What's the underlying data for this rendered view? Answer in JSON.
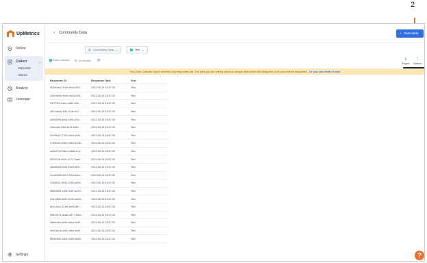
{
  "annotation": {
    "step_number": "2"
  },
  "brand": {
    "name": "UpMetrics",
    "accent": "#e8722c",
    "primary": "#2f6fde"
  },
  "sidebar": {
    "define": "Define",
    "collect": "Collect",
    "collect_sub": [
      "Data sets",
      "Stories"
    ],
    "analyze": "Analyze",
    "leverage": "Leverage",
    "settings": "Settings"
  },
  "header": {
    "title": "Community Data",
    "data_table_button": "Data table"
  },
  "tabs": [
    {
      "label": "Community Data",
      "active": false
    },
    {
      "label": "Test",
      "active": true
    }
  ],
  "toolbar": {
    "data_collector": "Data Collector",
    "records": "18 records",
    "export_label": "Export",
    "options_label": "Options",
    "options_tooltip": "Data Collector Options"
  },
  "banner": {
    "text": "This Data Collector hasn't received any responses yet. The data you are seeing below is sample data which will disappear once you receive responses.",
    "link": "Or you can delete it now."
  },
  "table": {
    "headers": [
      "Response ID",
      "Response Date",
      "Test"
    ],
    "rows": [
      [
        "003d0da2-3c8d-4b4a-8b3…",
        "2024-08-15 18:57:30",
        "Test"
      ],
      [
        "2a9ed4ee-0beb-4b45-808…",
        "2024-08-15 18:57:30",
        "Test"
      ],
      [
        "33f77f42-3a2a-4583-8d9…",
        "2024-08-15 18:57:30",
        "Test"
      ],
      [
        "3801a6c6-3f3e-414e-9e7…",
        "2024-08-15 18:57:30",
        "Test"
      ],
      [
        "a69d09f8-aec8-4e91-b6d…",
        "2024-08-15 18:57:30",
        "Test"
      ],
      [
        "226ecffa-24f4-4e21-b0f9-…",
        "2024-08-15 18:57:30",
        "Test"
      ],
      [
        "2e29f916-7763-49e3-82fe…",
        "2024-08-15 18:57:30",
        "Test"
      ],
      [
        "c755f162-93b4-49e2-b108…",
        "2024-08-15 18:57:30",
        "Test"
      ],
      [
        "ad9b9733-28ed-4368-a7d…",
        "2024-08-15 18:57:30",
        "Test"
      ],
      [
        "6f2097df-a92e-4171-9aa9…",
        "2024-08-15 18:57:30",
        "Test"
      ],
      [
        "3dc5808f-d4cb-4ae6-af2e…",
        "2024-08-15 18:57:30",
        "Test"
      ],
      [
        "3ced0988-3c07-4f15-a5ce…",
        "2024-08-15 18:57:30",
        "Test"
      ],
      [
        "11b5f0b1-9e05-4056-a60e…",
        "2024-08-15 18:57:30",
        "Test"
      ],
      [
        "38659831-c16f-4487-a229…",
        "2024-08-15 18:57:30",
        "Test"
      ],
      [
        "b4619f69-d087-4740-a634…",
        "2024-08-15 18:57:30",
        "Test"
      ],
      [
        "6e1c1bcc-6186-4a69-891…",
        "2024-08-15 18:57:30",
        "Test"
      ],
      [
        "06d42e71-d5a6-4877-8641…",
        "2024-08-15 18:57:30",
        "Test"
      ],
      [
        "0f8eee6d-bb5b-4bea-9c8f…",
        "2024-08-15 18:57:30",
        "Test"
      ],
      [
        "0e00ab2b-4d50-4fee-aef3…",
        "2024-08-15 18:57:30",
        "Test"
      ],
      [
        "f964b9a0-10be-44a9-a6e6…",
        "2024-08-15 18:57:30",
        "Test"
      ]
    ]
  }
}
